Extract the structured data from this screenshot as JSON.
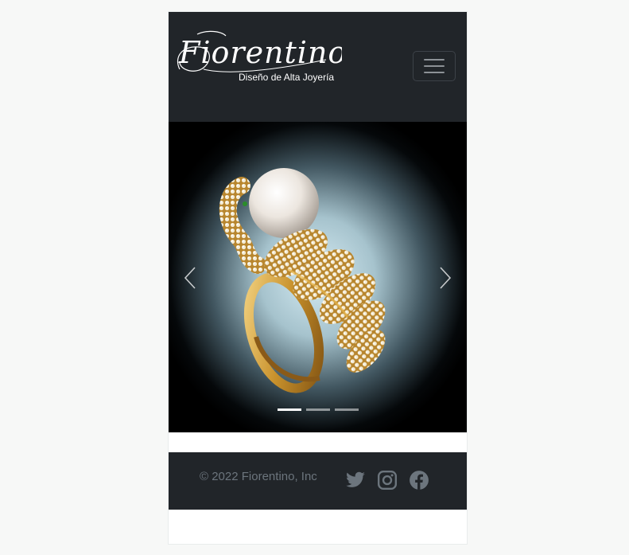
{
  "brand": {
    "name": "Fiorentino",
    "tagline": "Diseño de Alta Joyería"
  },
  "carousel": {
    "slide_count": 3,
    "active_index": 0,
    "image_subject": "gold-serpent-pearl-ring"
  },
  "footer": {
    "copyright": "© 2022 Fiorentino, Inc",
    "social": [
      "twitter-icon",
      "instagram-icon",
      "facebook-icon"
    ]
  },
  "colors": {
    "navbar_bg": "#212529",
    "footer_bg": "#212529",
    "footer_text": "#6c757d",
    "page_bg": "#f7f8f7"
  }
}
